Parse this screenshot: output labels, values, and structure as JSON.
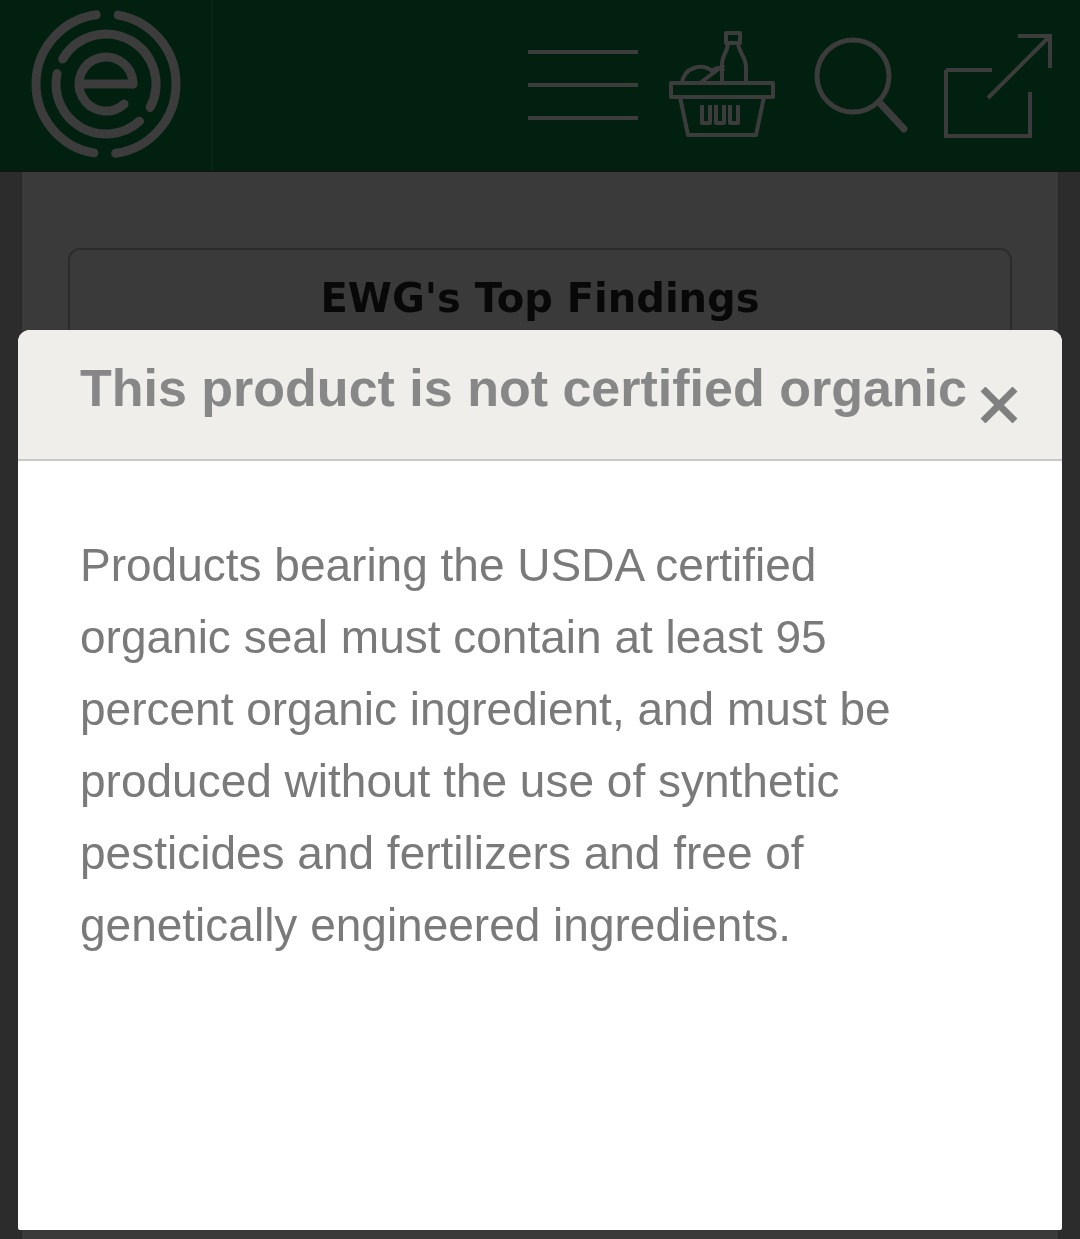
{
  "findings_card": {
    "title": "EWG's Top Findings"
  },
  "dialog": {
    "title": "This product is not certified organic",
    "body": "Products bearing the USDA certified organic seal must contain at least 95 percent organic ingredient, and must be produced without the use of synthetic pesticides and fertilizers and free of genetically engineered ingredients."
  }
}
